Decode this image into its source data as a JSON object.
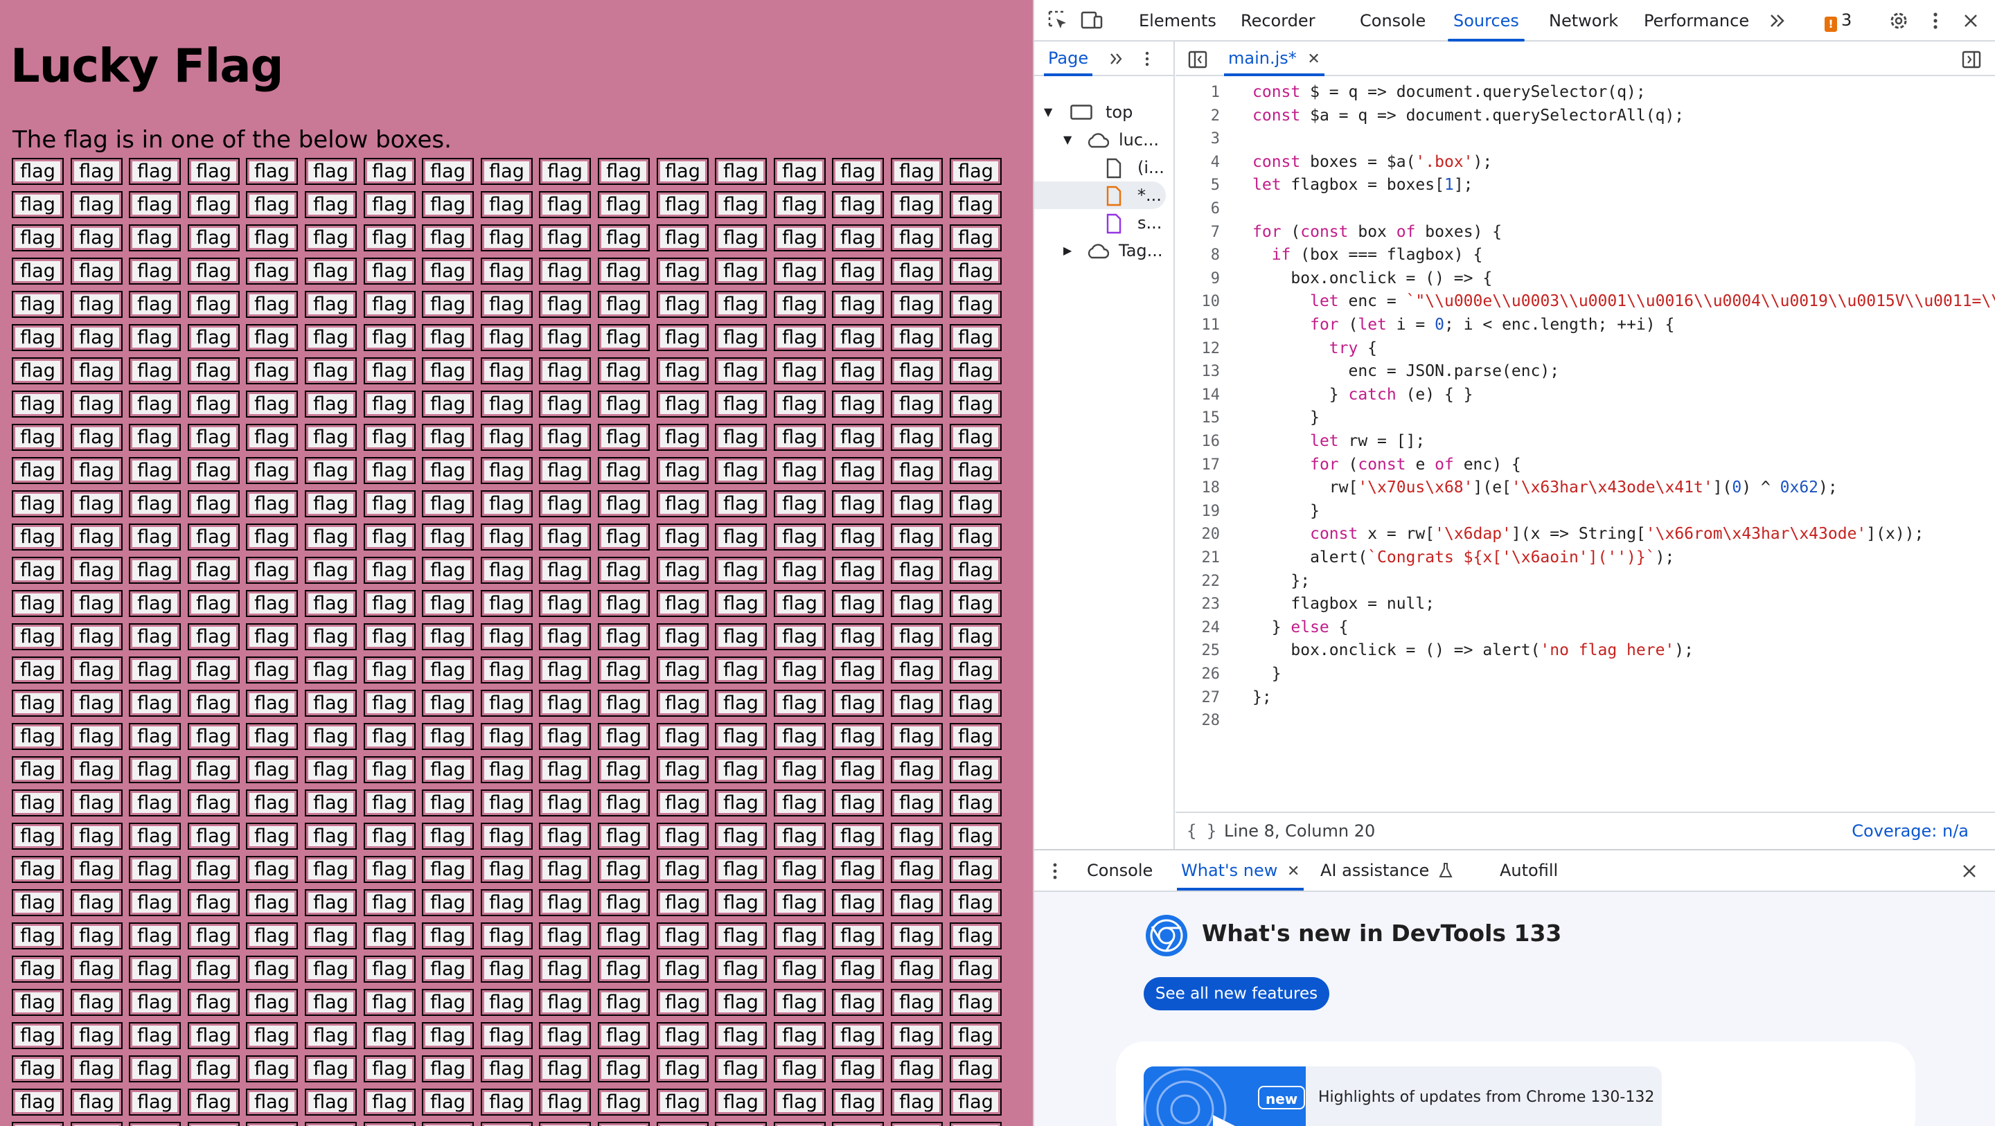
{
  "page": {
    "title": "Lucky Flag",
    "intro": "The flag is in one of the below boxes.",
    "box_label": "flag",
    "grid": {
      "columns": 17,
      "visible_rows": 30
    },
    "background": "#c97895"
  },
  "devtools": {
    "tabs": [
      "Elements",
      "Recorder",
      "Console",
      "Sources",
      "Network",
      "Performance"
    ],
    "active_tab": "Sources",
    "issues_count": "3",
    "navigator": {
      "tab": "Page",
      "tree": [
        {
          "label": "top",
          "icon": "frame-icon"
        },
        {
          "label": "luc...",
          "icon": "cloud-icon"
        },
        {
          "label": "(i...",
          "icon": "file-icon"
        },
        {
          "label": "*...",
          "icon": "file-js-icon"
        },
        {
          "label": "s...",
          "icon": "file-css-icon"
        },
        {
          "label": "Tag...",
          "icon": "cloud-icon"
        }
      ]
    },
    "editor": {
      "file_tab": "main.js*",
      "status_position": "Line 8, Column 20",
      "coverage": "Coverage: n/a",
      "lines": [
        "const $ = q => document.querySelector(q);",
        "const $a = q => document.querySelectorAll(q);",
        "",
        "const boxes = $a('.box');",
        "let flagbox = boxes[1];",
        "",
        "for (const box of boxes) {",
        "  if (box === flagbox) {",
        "    box.onclick = () => {",
        "      let enc = `\"\\\\u000e\\\\u0003\\\\u0001\\\\u0016\\\\u0004\\\\u0019\\\\u0015V\\\\u0011=\\\\u00",
        "      for (let i = 0; i < enc.length; ++i) {",
        "        try {",
        "          enc = JSON.parse(enc);",
        "        } catch (e) { }",
        "      }",
        "      let rw = [];",
        "      for (const e of enc) {",
        "        rw['\\x70us\\x68'](e['\\x63har\\x43ode\\x41t'](0) ^ 0x62);",
        "      }",
        "      const x = rw['\\x6dap'](x => String['\\x66rom\\x43har\\x43ode'](x));",
        "      alert(`Congrats ${x['\\x6aoin']('')}`);",
        "    };",
        "    flagbox = null;",
        "  } else {",
        "    box.onclick = () => alert('no flag here');",
        "  }",
        "};",
        ""
      ]
    },
    "drawer": {
      "tabs": [
        "Console",
        "What's new",
        "AI assistance",
        "Autofill"
      ],
      "active_tab": "What's new",
      "whats_new_title": "What's new in DevTools 133",
      "see_all_button": "See all new features",
      "highlight_badge": "new",
      "highlight_text": "Highlights of updates from Chrome 130-132"
    }
  }
}
